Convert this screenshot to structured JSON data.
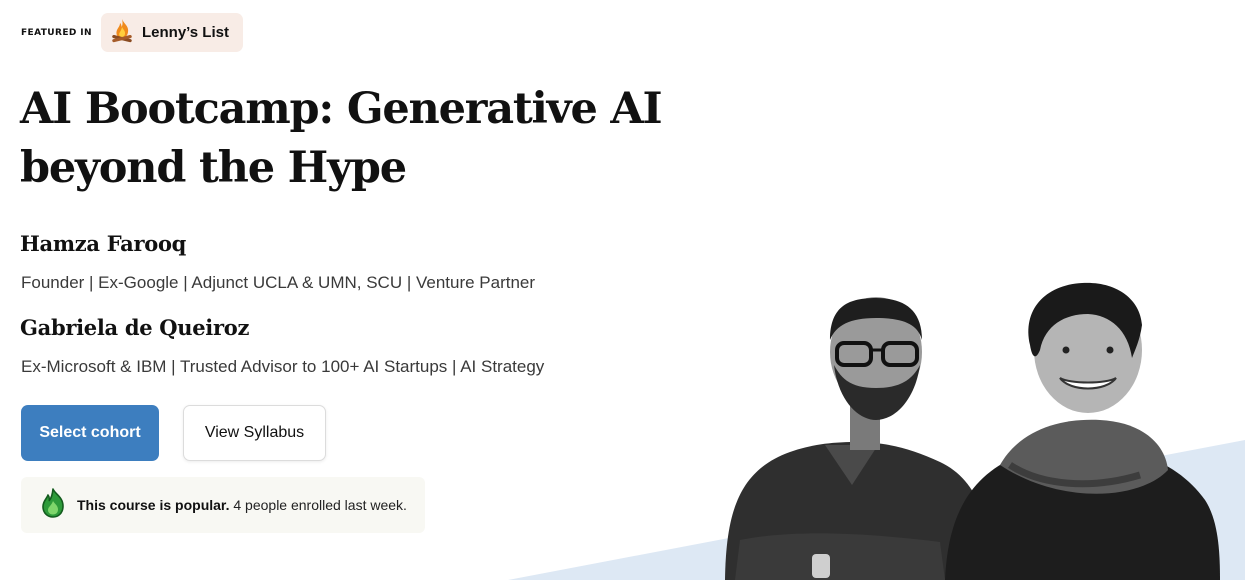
{
  "featured": {
    "label": "FEATURED IN",
    "source": "Lenny’s List",
    "icon": "campfire-icon"
  },
  "course": {
    "title_line1": "AI Bootcamp: Generative AI",
    "title_line2": "beyond the Hype"
  },
  "instructors": [
    {
      "name": "Hamza Farooq",
      "bio": "Founder | Ex-Google | Adjunct UCLA & UMN, SCU | Venture Partner"
    },
    {
      "name": "Gabriela de Queiroz",
      "bio": "Ex-Microsoft & IBM | Trusted Advisor to 100+ AI Startups | AI Strategy"
    }
  ],
  "actions": {
    "select_cohort": "Select cohort",
    "view_syllabus": "View Syllabus"
  },
  "popularity": {
    "icon": "flame-icon",
    "headline": "This course is popular.",
    "detail": "4 people enrolled last week."
  },
  "colors": {
    "primary": "#3d7ebf",
    "badge_bg": "#f8ece6",
    "popular_bg": "#f8f8f3",
    "flame": "#2e9b3a",
    "accent_shape": "#dde8f4"
  }
}
